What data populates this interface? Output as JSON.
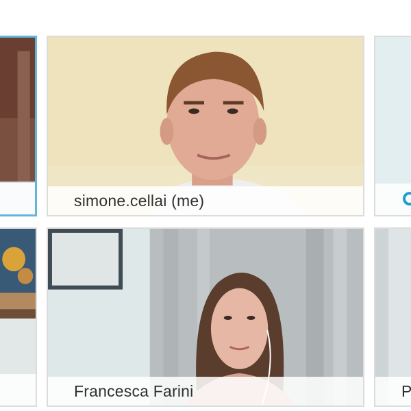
{
  "participants": [
    {
      "id": "left-top",
      "name": "",
      "is_active_speaker": true
    },
    {
      "id": "simone",
      "name": "simone.cellai (me)",
      "is_active_speaker": false
    },
    {
      "id": "right-top",
      "name": "",
      "is_active_speaker": false
    },
    {
      "id": "left-bottom",
      "name": "",
      "is_active_speaker": false
    },
    {
      "id": "francesca",
      "name": "Francesca Farini",
      "is_active_speaker": false
    },
    {
      "id": "right-bottom",
      "name": "P",
      "is_active_speaker": false
    }
  ],
  "icons": {
    "right_top_status": "loading-ring-icon"
  },
  "colors": {
    "active_border": "#63b5da",
    "ring": "#1e9fcf"
  }
}
